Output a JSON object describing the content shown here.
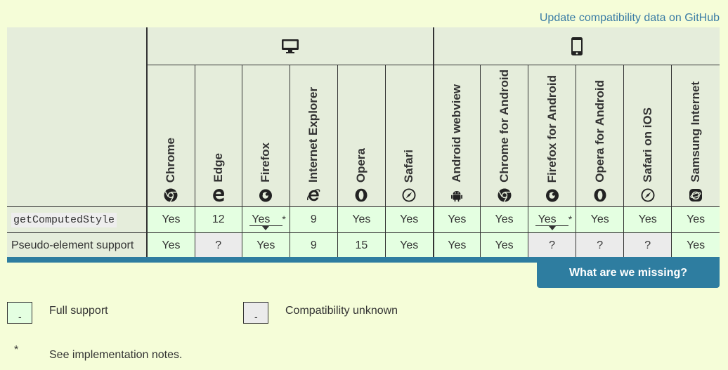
{
  "github_link": "Update compatibility data on GitHub",
  "platforms": [
    {
      "name": "desktop-icon"
    },
    {
      "name": "mobile-icon"
    }
  ],
  "browsers": [
    {
      "label": "Chrome",
      "icon": "chrome-icon"
    },
    {
      "label": "Edge",
      "icon": "edge-icon"
    },
    {
      "label": "Firefox",
      "icon": "firefox-icon"
    },
    {
      "label": "Internet Explorer",
      "icon": "ie-icon"
    },
    {
      "label": "Opera",
      "icon": "opera-icon"
    },
    {
      "label": "Safari",
      "icon": "safari-icon"
    },
    {
      "label": "Android webview",
      "icon": "android-icon"
    },
    {
      "label": "Chrome for Android",
      "icon": "chrome-icon"
    },
    {
      "label": "Firefox for Android",
      "icon": "firefox-icon"
    },
    {
      "label": "Opera for Android",
      "icon": "opera-icon"
    },
    {
      "label": "Safari on iOS",
      "icon": "safari-icon"
    },
    {
      "label": "Samsung Internet",
      "icon": "samsung-icon"
    }
  ],
  "rows": [
    {
      "feature": "getComputedStyle",
      "code": true,
      "cells": [
        {
          "text": "Yes",
          "status": "yes"
        },
        {
          "text": "12",
          "status": "yes"
        },
        {
          "text": "Yes",
          "status": "yes",
          "note": true
        },
        {
          "text": "9",
          "status": "yes"
        },
        {
          "text": "Yes",
          "status": "yes"
        },
        {
          "text": "Yes",
          "status": "yes"
        },
        {
          "text": "Yes",
          "status": "yes"
        },
        {
          "text": "Yes",
          "status": "yes"
        },
        {
          "text": "Yes",
          "status": "yes",
          "note": true
        },
        {
          "text": "Yes",
          "status": "yes"
        },
        {
          "text": "Yes",
          "status": "yes"
        },
        {
          "text": "Yes",
          "status": "yes"
        }
      ]
    },
    {
      "feature": "Pseudo-element support",
      "code": false,
      "cells": [
        {
          "text": "Yes",
          "status": "yes"
        },
        {
          "text": "?",
          "status": "unknown"
        },
        {
          "text": "Yes",
          "status": "yes"
        },
        {
          "text": "9",
          "status": "yes"
        },
        {
          "text": "15",
          "status": "yes"
        },
        {
          "text": "Yes",
          "status": "yes"
        },
        {
          "text": "Yes",
          "status": "yes"
        },
        {
          "text": "Yes",
          "status": "yes"
        },
        {
          "text": "?",
          "status": "unknown"
        },
        {
          "text": "?",
          "status": "unknown"
        },
        {
          "text": "?",
          "status": "unknown"
        },
        {
          "text": "Yes",
          "status": "yes"
        }
      ]
    }
  ],
  "missing_button": "What are we missing?",
  "legend": {
    "full_support_box": "-",
    "full_support": "Full support",
    "unknown_box": "-",
    "unknown": "Compatibility unknown",
    "star": "*",
    "notes": "See implementation notes."
  },
  "colors": {
    "background": "#f5fdd8",
    "header": "#e5eddb",
    "yes": "#e4ffe1",
    "unknown": "#ebebeb",
    "accent": "#2e7da0",
    "link": "#3a7ca5"
  }
}
